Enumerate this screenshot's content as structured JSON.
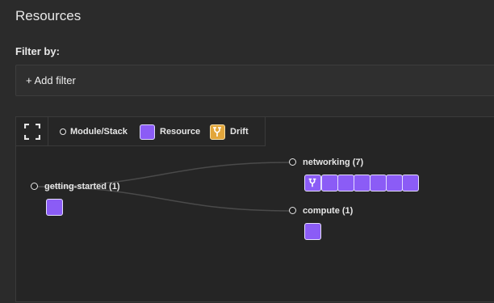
{
  "header": {
    "title": "Resources"
  },
  "filters": {
    "label": "Filter by:",
    "add_filter_label": "+ Add filter"
  },
  "legend": {
    "module_stack_label": "Module/Stack",
    "resource_label": "Resource",
    "drift_label": "Drift"
  },
  "colors": {
    "resource": "#8b5cf6",
    "drift": "#e2a63b",
    "background": "#2b2b2b"
  },
  "graph": {
    "nodes": [
      {
        "id": "getting-started",
        "label": "getting-started (1)",
        "resource_count": 1,
        "drifted_count": 0
      },
      {
        "id": "networking",
        "label": "networking (7)",
        "resource_count": 7,
        "drifted_count": 1
      },
      {
        "id": "compute",
        "label": "compute (1)",
        "resource_count": 1,
        "drifted_count": 0
      }
    ],
    "edges": [
      {
        "from": "getting-started",
        "to": "networking"
      },
      {
        "from": "getting-started",
        "to": "compute"
      }
    ]
  }
}
